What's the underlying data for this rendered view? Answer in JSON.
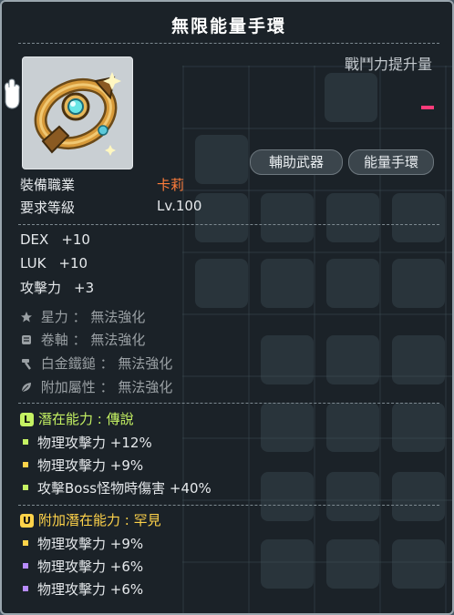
{
  "title": "無限能量手環",
  "combat_power_label": "戰鬥力提升量",
  "tags": [
    "輔助武器",
    "能量手環"
  ],
  "requirements": {
    "job_label": "裝備職業",
    "job_value": "卡莉",
    "level_label": "要求等級",
    "level_value": "Lv.100"
  },
  "stats": [
    {
      "name": "DEX",
      "value": "+10"
    },
    {
      "name": "LUK",
      "value": "+10"
    },
    {
      "name": "攻擊力",
      "value": "+3"
    }
  ],
  "enhancements": [
    {
      "label": "星力",
      "value": "無法強化",
      "icon": "star-icon"
    },
    {
      "label": "卷軸",
      "value": "無法強化",
      "icon": "scroll-icon"
    },
    {
      "label": "白金鐵鎚",
      "value": "無法強化",
      "icon": "hammer-icon"
    },
    {
      "label": "附加屬性",
      "value": "無法強化",
      "icon": "leaf-icon"
    }
  ],
  "potential": {
    "badge": "L",
    "label": "潛在能力",
    "separator": ":",
    "grade": "傳說",
    "color": "#c5f263",
    "lines": [
      {
        "text": "物理攻擊力",
        "value": "+12%",
        "bullet_color": "#c5f263"
      },
      {
        "text": "物理攻擊力",
        "value": "+9%",
        "bullet_color": "#ffd34a"
      },
      {
        "text": "攻擊Boss怪物時傷害",
        "value": "+40%",
        "bullet_color": "#c5f263"
      }
    ]
  },
  "bonus_potential": {
    "badge": "U",
    "label": "附加潛在能力",
    "separator": ":",
    "grade": "罕見",
    "color": "#ffd34a",
    "lines": [
      {
        "text": "物理攻擊力",
        "value": "+9%",
        "bullet_color": "#ffd34a"
      },
      {
        "text": "物理攻擊力",
        "value": "+6%",
        "bullet_color": "#b88cff"
      },
      {
        "text": "物理攻擊力",
        "value": "+6%",
        "bullet_color": "#b88cff"
      }
    ]
  }
}
